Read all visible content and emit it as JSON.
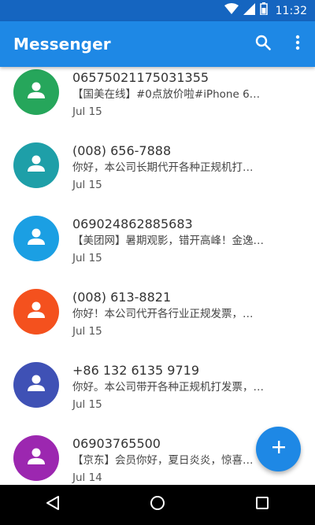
{
  "status_bar": {
    "time": "11:32"
  },
  "app_bar": {
    "title": "Messenger",
    "search_icon": "search-icon",
    "overflow_icon": "more-vert-icon"
  },
  "conversations": [
    {
      "sender": "06575021175031355",
      "snippet": "【国美在线】#0点放价啦#iPhone 6…",
      "date": "Jul 15",
      "avatar_color": "#26A65B"
    },
    {
      "sender": "(008) 656-7888",
      "snippet": "你好，本公司长期代开各种正规机打…",
      "date": "Jul 15",
      "avatar_color": "#1E9FA8"
    },
    {
      "sender": "069024862885683",
      "snippet": "【美团网】暑期观影，错开高峰！金逸…",
      "date": "Jul 15",
      "avatar_color": "#1B9FE3"
    },
    {
      "sender": "(008) 613-8821",
      "snippet": "你好！本公司代开各行业正规发票，…",
      "date": "Jul 15",
      "avatar_color": "#F4511E"
    },
    {
      "sender": "+86 132 6135 9719",
      "snippet": "你好。本公司带开各种正规机打发票，…",
      "date": "Jul 15",
      "avatar_color": "#3F51B5"
    },
    {
      "sender": "06903765500",
      "snippet": "【京东】会员你好，夏日炎炎，惊喜…",
      "date": "Jul 14",
      "avatar_color": "#9C27B0"
    }
  ],
  "fab": {
    "icon": "add-icon"
  },
  "nav": {
    "back_icon": "back-icon",
    "home_icon": "home-icon",
    "recents_icon": "recents-icon"
  }
}
